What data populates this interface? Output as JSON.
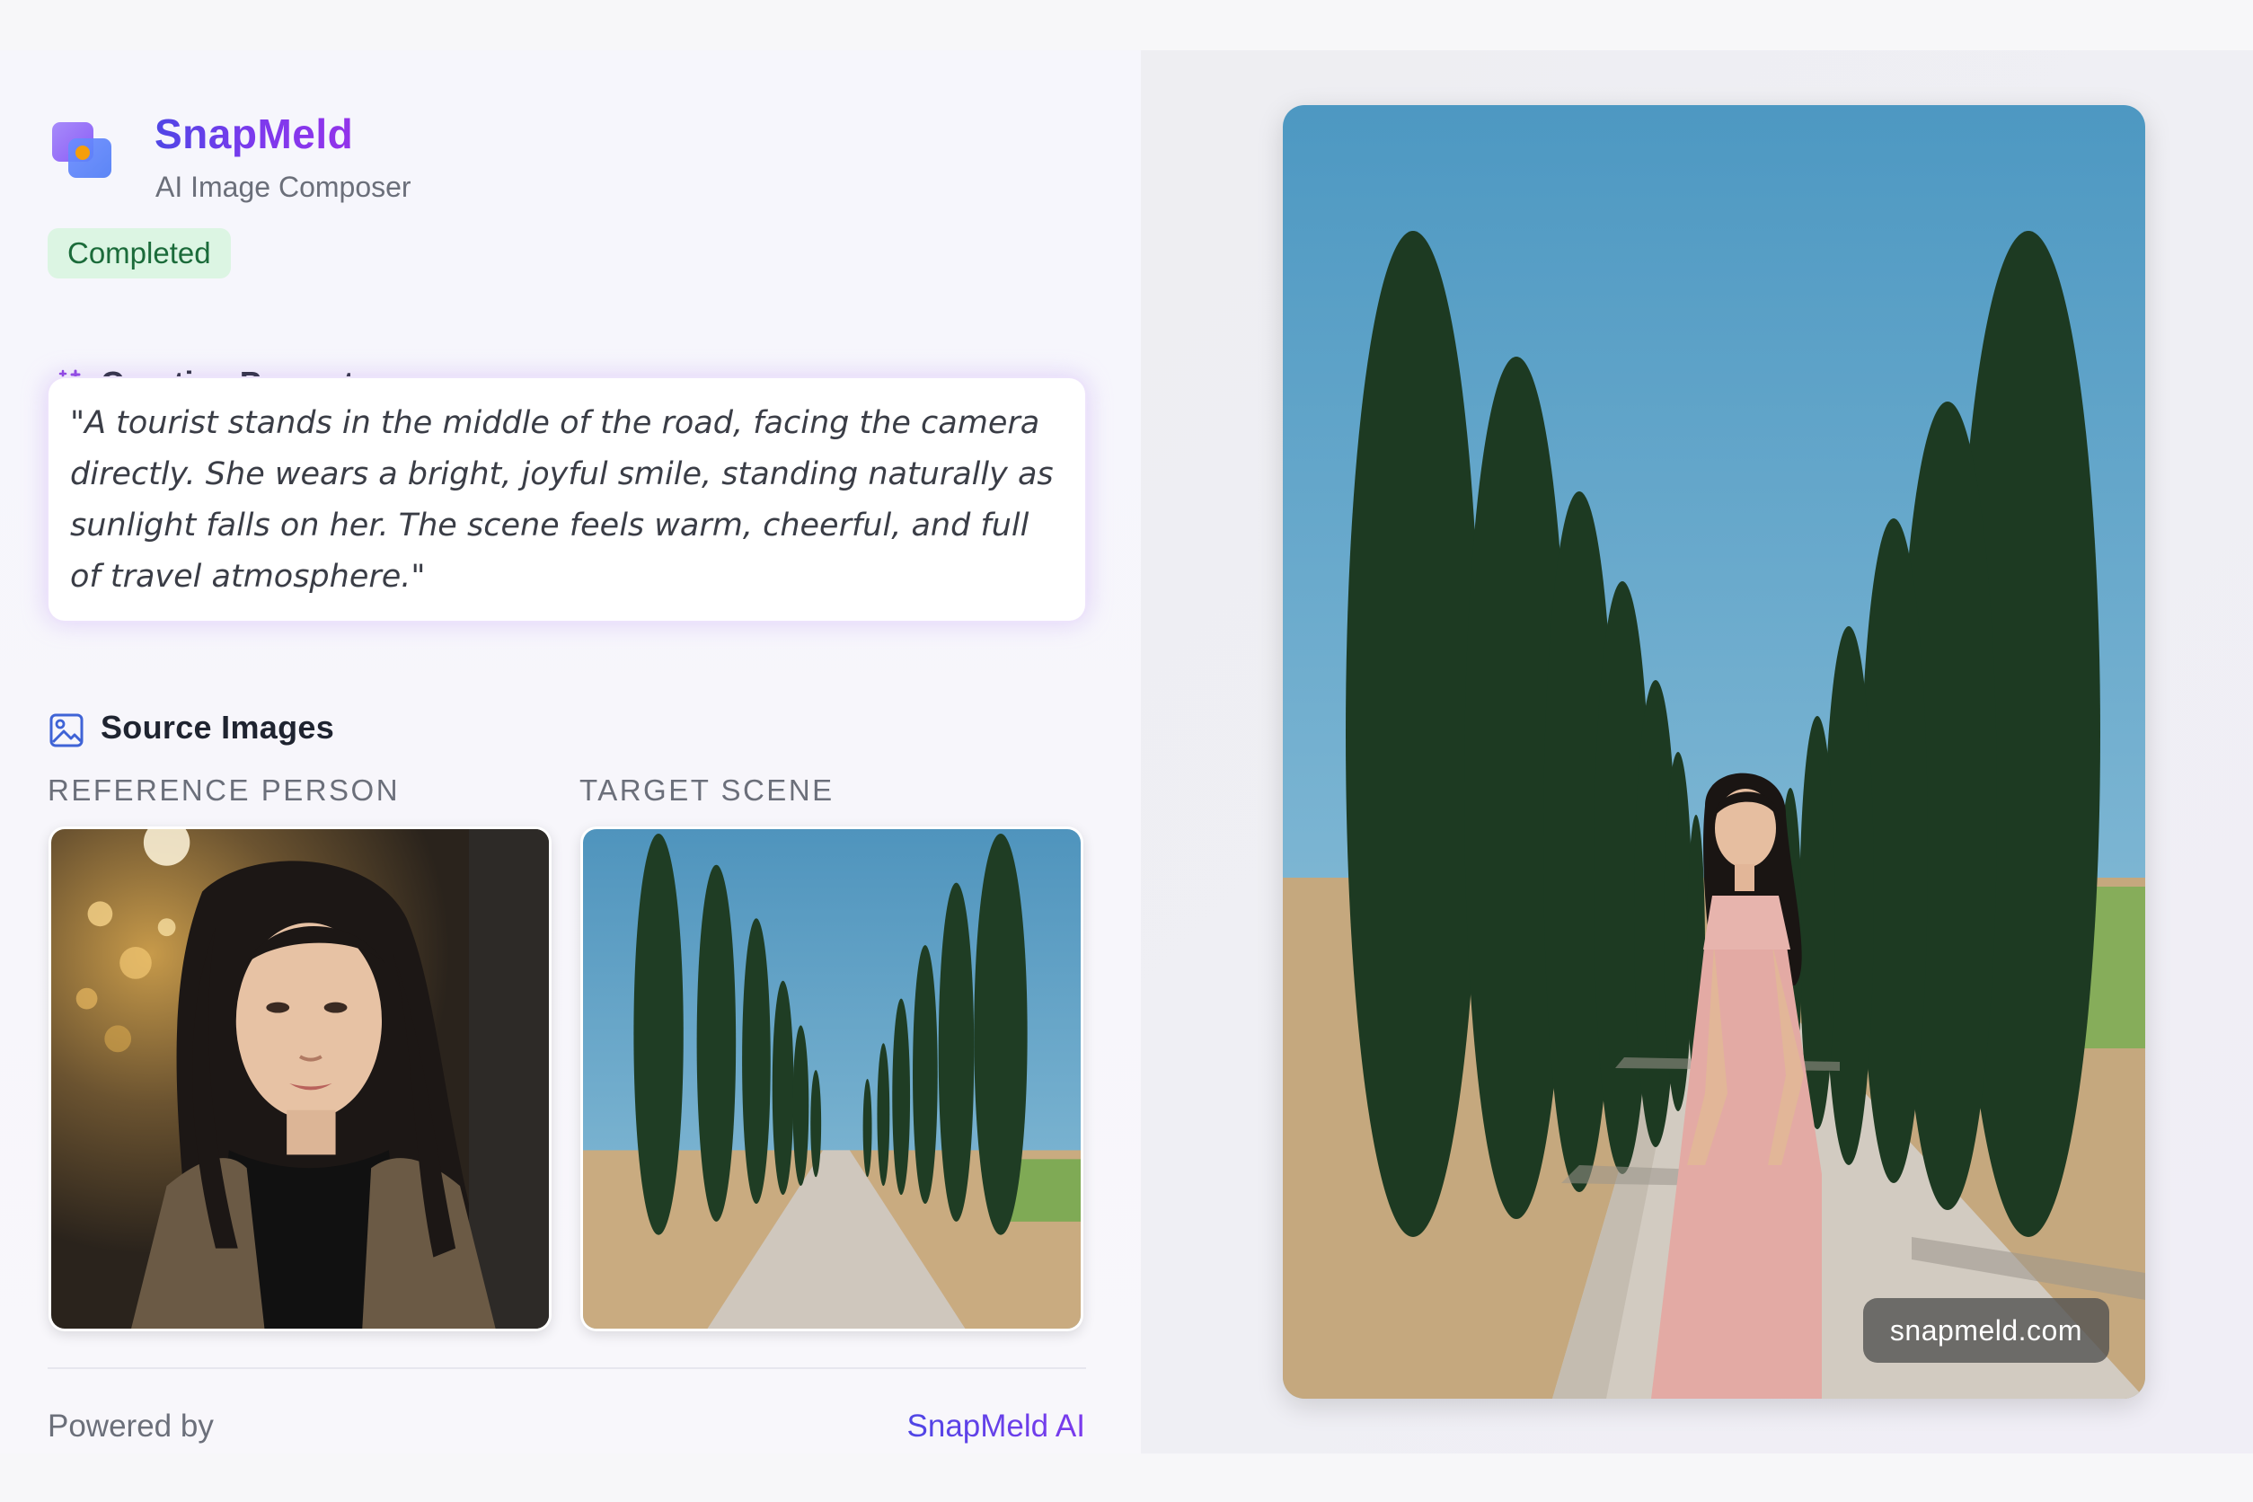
{
  "app": {
    "name": "SnapMeld",
    "subtitle": "AI Image Composer",
    "status": "Completed"
  },
  "prompt": {
    "title": "Creative Prompt",
    "text": "\"A tourist stands in the middle of the road, facing the camera directly. She wears a bright, joyful smile, standing naturally as sunlight falls on her. The scene feels warm, cheerful, and full of travel atmosphere.\""
  },
  "sources": {
    "title": "Source Images",
    "reference_label": "REFERENCE PERSON",
    "target_label": "TARGET SCENE"
  },
  "footer": {
    "powered_by": "Powered by",
    "link": "SnapMeld AI"
  },
  "result": {
    "watermark": "snapmeld.com"
  },
  "colors": {
    "brand": "#6d3ae8",
    "badge_bg": "#dcf5e3",
    "badge_text": "#1b6b3a",
    "sky": "#5fa3c7"
  },
  "icons": {
    "logo": "snapmeld-logo-icon",
    "prompt": "magic-wand-icon",
    "sources": "image-icon"
  }
}
